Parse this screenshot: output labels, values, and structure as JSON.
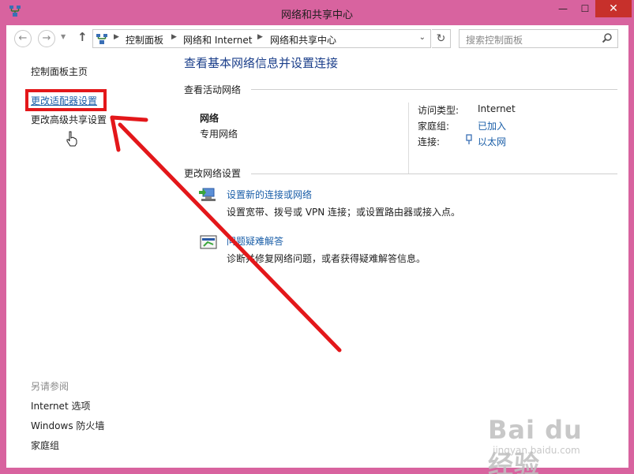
{
  "window": {
    "title": "网络和共享中心",
    "minimize_glyph": "—",
    "maximize_glyph": "☐",
    "close_glyph": "✕"
  },
  "nav": {
    "back_icon": "back-arrow-icon",
    "forward_icon": "forward-arrow-icon",
    "up_icon": "up-arrow-icon",
    "breadcrumbs": [
      "控制面板",
      "网络和 Internet",
      "网络和共享中心"
    ],
    "search_placeholder": "搜索控制面板"
  },
  "sidebar": {
    "home": "控制面板主页",
    "links": [
      "更改适配器设置",
      "更改高级共享设置"
    ],
    "see_also_title": "另请参阅",
    "see_also": [
      "Internet 选项",
      "Windows 防火墙",
      "家庭组"
    ]
  },
  "main": {
    "heading": "查看基本网络信息并设置连接",
    "active_section": "查看活动网络",
    "network": {
      "name": "网络",
      "type": "专用网络",
      "details": [
        {
          "key": "访问类型:",
          "value": "Internet",
          "link": false
        },
        {
          "key": "家庭组:",
          "value": "已加入",
          "link": true
        },
        {
          "key": "连接:",
          "value": "以太网",
          "link": true
        }
      ]
    },
    "change_section": "更改网络设置",
    "tasks": [
      {
        "title": "设置新的连接或网络",
        "desc": "设置宽带、拨号或 VPN 连接；或设置路由器或接入点。",
        "icon": "network-setup-icon"
      },
      {
        "title": "问题疑难解答",
        "desc": "诊断并修复网络问题，或者获得疑难解答信息。",
        "icon": "troubleshoot-icon"
      }
    ]
  },
  "watermark": {
    "main": "Bai du 经验",
    "sub": "jingyan.baidu.com"
  },
  "colors": {
    "frame": "#d8639f",
    "link": "#1a5ea8",
    "heading": "#1a3e8a",
    "annotation_red": "#e3171a"
  }
}
